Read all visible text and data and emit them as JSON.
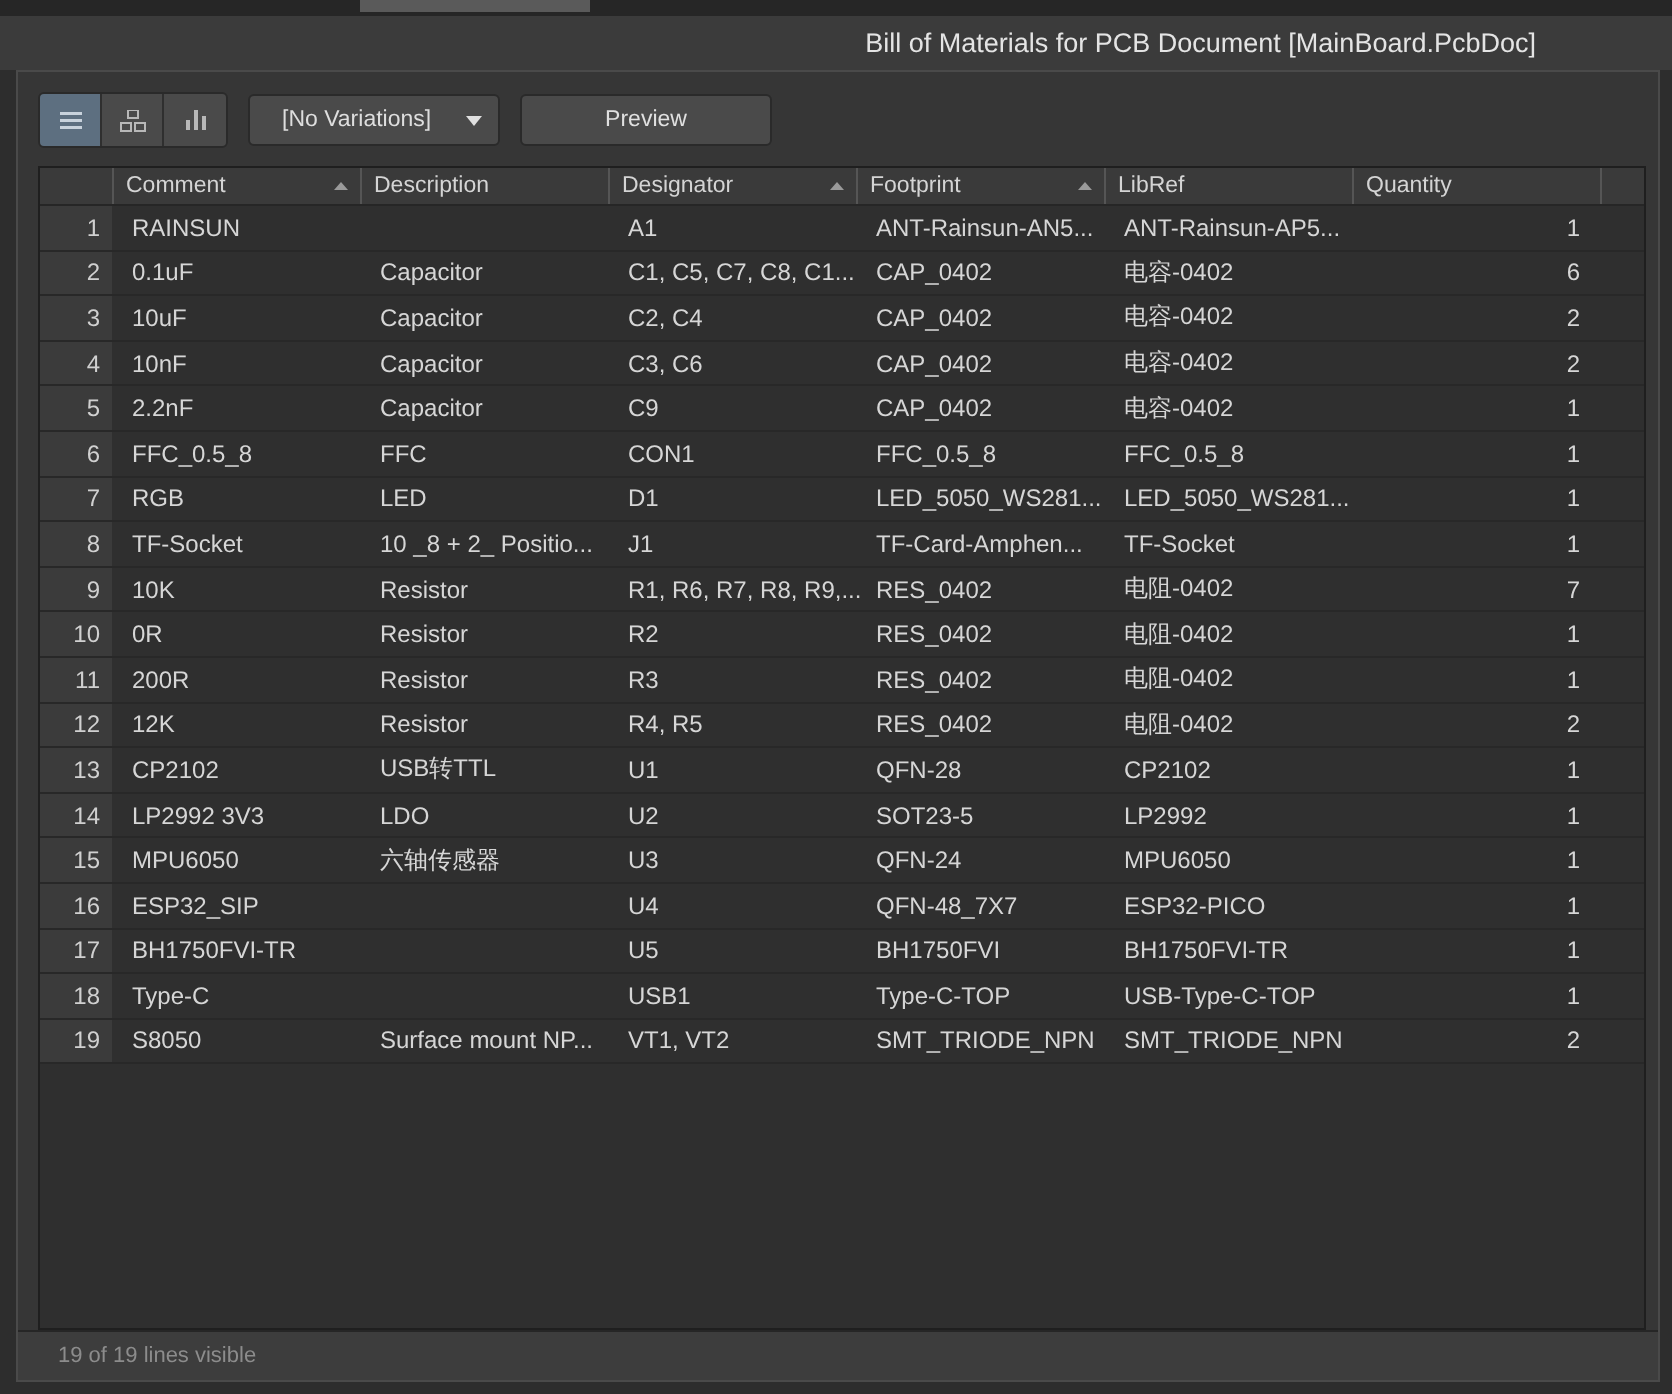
{
  "window": {
    "title": "Bill of Materials for PCB Document [MainBoard.PcbDoc]"
  },
  "view_buttons": [
    {
      "kind": "list",
      "selected": true
    },
    {
      "kind": "tree",
      "selected": false
    },
    {
      "kind": "chart",
      "selected": false
    }
  ],
  "variant_dropdown": {
    "value": "[No Variations]"
  },
  "preview_button": "Preview",
  "table": {
    "columns": [
      {
        "label": "Comment",
        "sorted": true
      },
      {
        "label": "Description",
        "sorted": false
      },
      {
        "label": "Designator",
        "sorted": true
      },
      {
        "label": "Footprint",
        "sorted": true
      },
      {
        "label": "LibRef",
        "sorted": false
      },
      {
        "label": "Quantity",
        "sorted": false
      }
    ],
    "rows": [
      {
        "number": "1",
        "comment": "RAINSUN",
        "designator": "A1",
        "footprint": "ANT-Rainsun-AN5...",
        "libref": "ANT-Rainsun-AP5...",
        "quantity": "1"
      },
      {
        "number": "2",
        "comment": "0.1uF",
        "description": "Capacitor",
        "designator": "C1, C5, C7, C8, C1...",
        "footprint": "CAP_0402",
        "libref": "电容-0402",
        "quantity": "6"
      },
      {
        "number": "3",
        "comment": "10uF",
        "description": "Capacitor",
        "designator": "C2, C4",
        "footprint": "CAP_0402",
        "libref": "电容-0402",
        "quantity": "2"
      },
      {
        "number": "4",
        "comment": "10nF",
        "description": "Capacitor",
        "designator": "C3, C6",
        "footprint": "CAP_0402",
        "libref": "电容-0402",
        "quantity": "2"
      },
      {
        "number": "5",
        "comment": "2.2nF",
        "description": "Capacitor",
        "designator": "C9",
        "footprint": "CAP_0402",
        "libref": "电容-0402",
        "quantity": "1"
      },
      {
        "number": "6",
        "comment": "FFC_0.5_8",
        "description": "FFC",
        "designator": "CON1",
        "footprint": "FFC_0.5_8",
        "libref": "FFC_0.5_8",
        "quantity": "1"
      },
      {
        "number": "7",
        "comment": "RGB",
        "description": "LED",
        "designator": "D1",
        "footprint": "LED_5050_WS281...",
        "libref": "LED_5050_WS281...",
        "quantity": "1"
      },
      {
        "number": "8",
        "comment": "TF-Socket",
        "description": "10 _8 + 2_ Positio...",
        "designator": "J1",
        "footprint": "TF-Card-Amphen...",
        "libref": "TF-Socket",
        "quantity": "1"
      },
      {
        "number": "9",
        "comment": "10K",
        "description": "Resistor",
        "designator": "R1, R6, R7, R8, R9,...",
        "footprint": "RES_0402",
        "libref": "电阻-0402",
        "quantity": "7"
      },
      {
        "number": "10",
        "comment": "0R",
        "description": "Resistor",
        "designator": "R2",
        "footprint": "RES_0402",
        "libref": "电阻-0402",
        "quantity": "1"
      },
      {
        "number": "11",
        "comment": "200R",
        "description": "Resistor",
        "designator": "R3",
        "footprint": "RES_0402",
        "libref": "电阻-0402",
        "quantity": "1"
      },
      {
        "number": "12",
        "comment": "12K",
        "description": "Resistor",
        "designator": "R4, R5",
        "footprint": "RES_0402",
        "libref": "电阻-0402",
        "quantity": "2"
      },
      {
        "number": "13",
        "comment": "CP2102",
        "description": "USB转TTL",
        "designator": "U1",
        "footprint": "QFN-28",
        "libref": "CP2102",
        "quantity": "1"
      },
      {
        "number": "14",
        "comment": "LP2992 3V3",
        "description": "LDO",
        "designator": "U2",
        "footprint": "SOT23-5",
        "libref": "LP2992",
        "quantity": "1"
      },
      {
        "number": "15",
        "comment": "MPU6050",
        "description": "六轴传感器",
        "designator": "U3",
        "footprint": "QFN-24",
        "libref": "MPU6050",
        "quantity": "1"
      },
      {
        "number": "16",
        "comment": "ESP32_SIP",
        "designator": "U4",
        "footprint": "QFN-48_7X7",
        "libref": "ESP32-PICO",
        "quantity": "1"
      },
      {
        "number": "17",
        "comment": "BH1750FVI-TR",
        "designator": "U5",
        "footprint": "BH1750FVI",
        "libref": "BH1750FVI-TR",
        "quantity": "1"
      },
      {
        "number": "18",
        "comment": "Type-C",
        "designator": "USB1",
        "footprint": "Type-C-TOP",
        "libref": "USB-Type-C-TOP",
        "quantity": "1"
      },
      {
        "number": "19",
        "comment": "S8050",
        "description": "Surface mount NP...",
        "designator": "VT1, VT2",
        "footprint": "SMT_TRIODE_NPN",
        "libref": "SMT_TRIODE_NPN",
        "quantity": "2"
      }
    ]
  },
  "status_bar": "19 of 19 lines visible"
}
